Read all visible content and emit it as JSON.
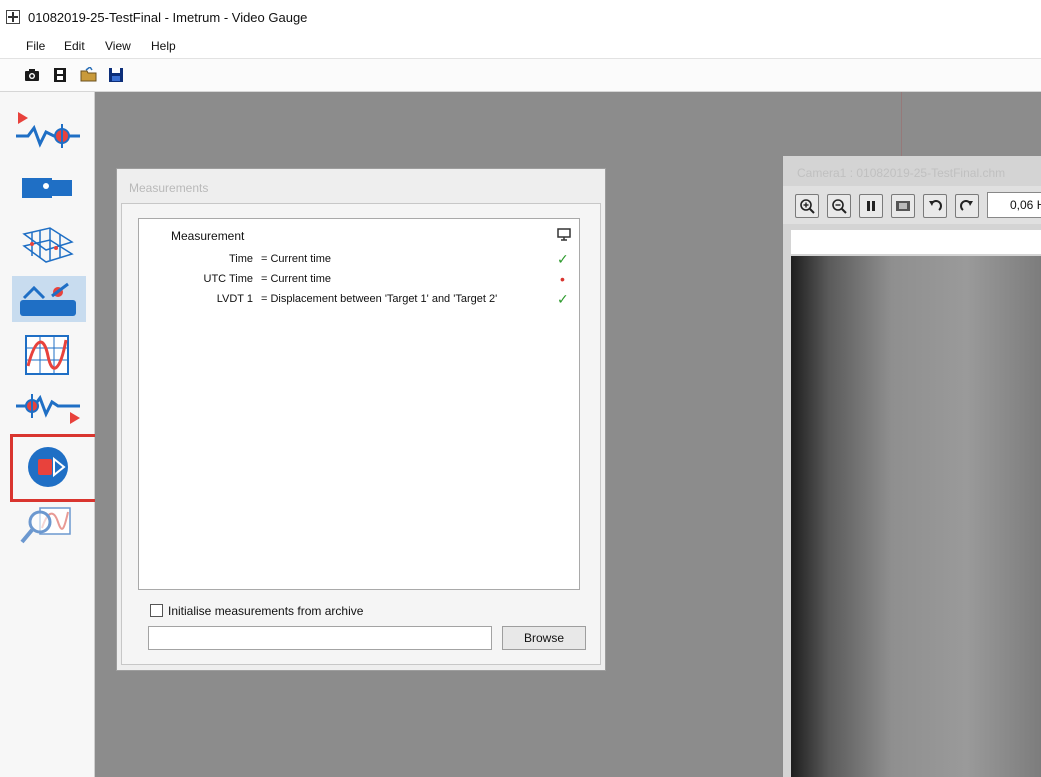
{
  "window": {
    "title": "01082019-25-TestFinal - Imetrum - Video Gauge"
  },
  "menu": {
    "items": [
      "File",
      "Edit",
      "View",
      "Help"
    ]
  },
  "toolbar": {
    "icons": [
      "camera-icon",
      "film-icon",
      "open-folder-icon",
      "save-icon"
    ]
  },
  "sidebar": {
    "icons": [
      "signal-input-icon",
      "camera-setup-icon",
      "calibration-grid-icon",
      "targets-icon",
      "graph-icon",
      "signal-output-icon",
      "record-icon",
      "analyse-icon"
    ],
    "active_index": 3,
    "highlighted_index": 6
  },
  "measurements_panel": {
    "title": "Measurements",
    "header": "Measurement",
    "rows": [
      {
        "name": "Time",
        "definition": "= Current time",
        "status": "✓"
      },
      {
        "name": "UTC Time",
        "definition": "= Current time",
        "status": "•"
      },
      {
        "name": "LVDT 1",
        "definition": "= Displacement between 'Target 1' and 'Target 2'",
        "status": "✓"
      }
    ],
    "archive_checkbox_label": "Initialise measurements from archive",
    "archive_path": "",
    "browse_label": "Browse"
  },
  "camera_panel": {
    "title": "Camera1 : 01082019-25-TestFinal.chm",
    "zoom_value": "0,06 H"
  },
  "colors": {
    "highlight": "#d9352f",
    "icon_blue": "#1f6fc5",
    "icon_red": "#e8423c",
    "active_bg": "#c8dcef",
    "workspace": "#8c8c8c"
  }
}
